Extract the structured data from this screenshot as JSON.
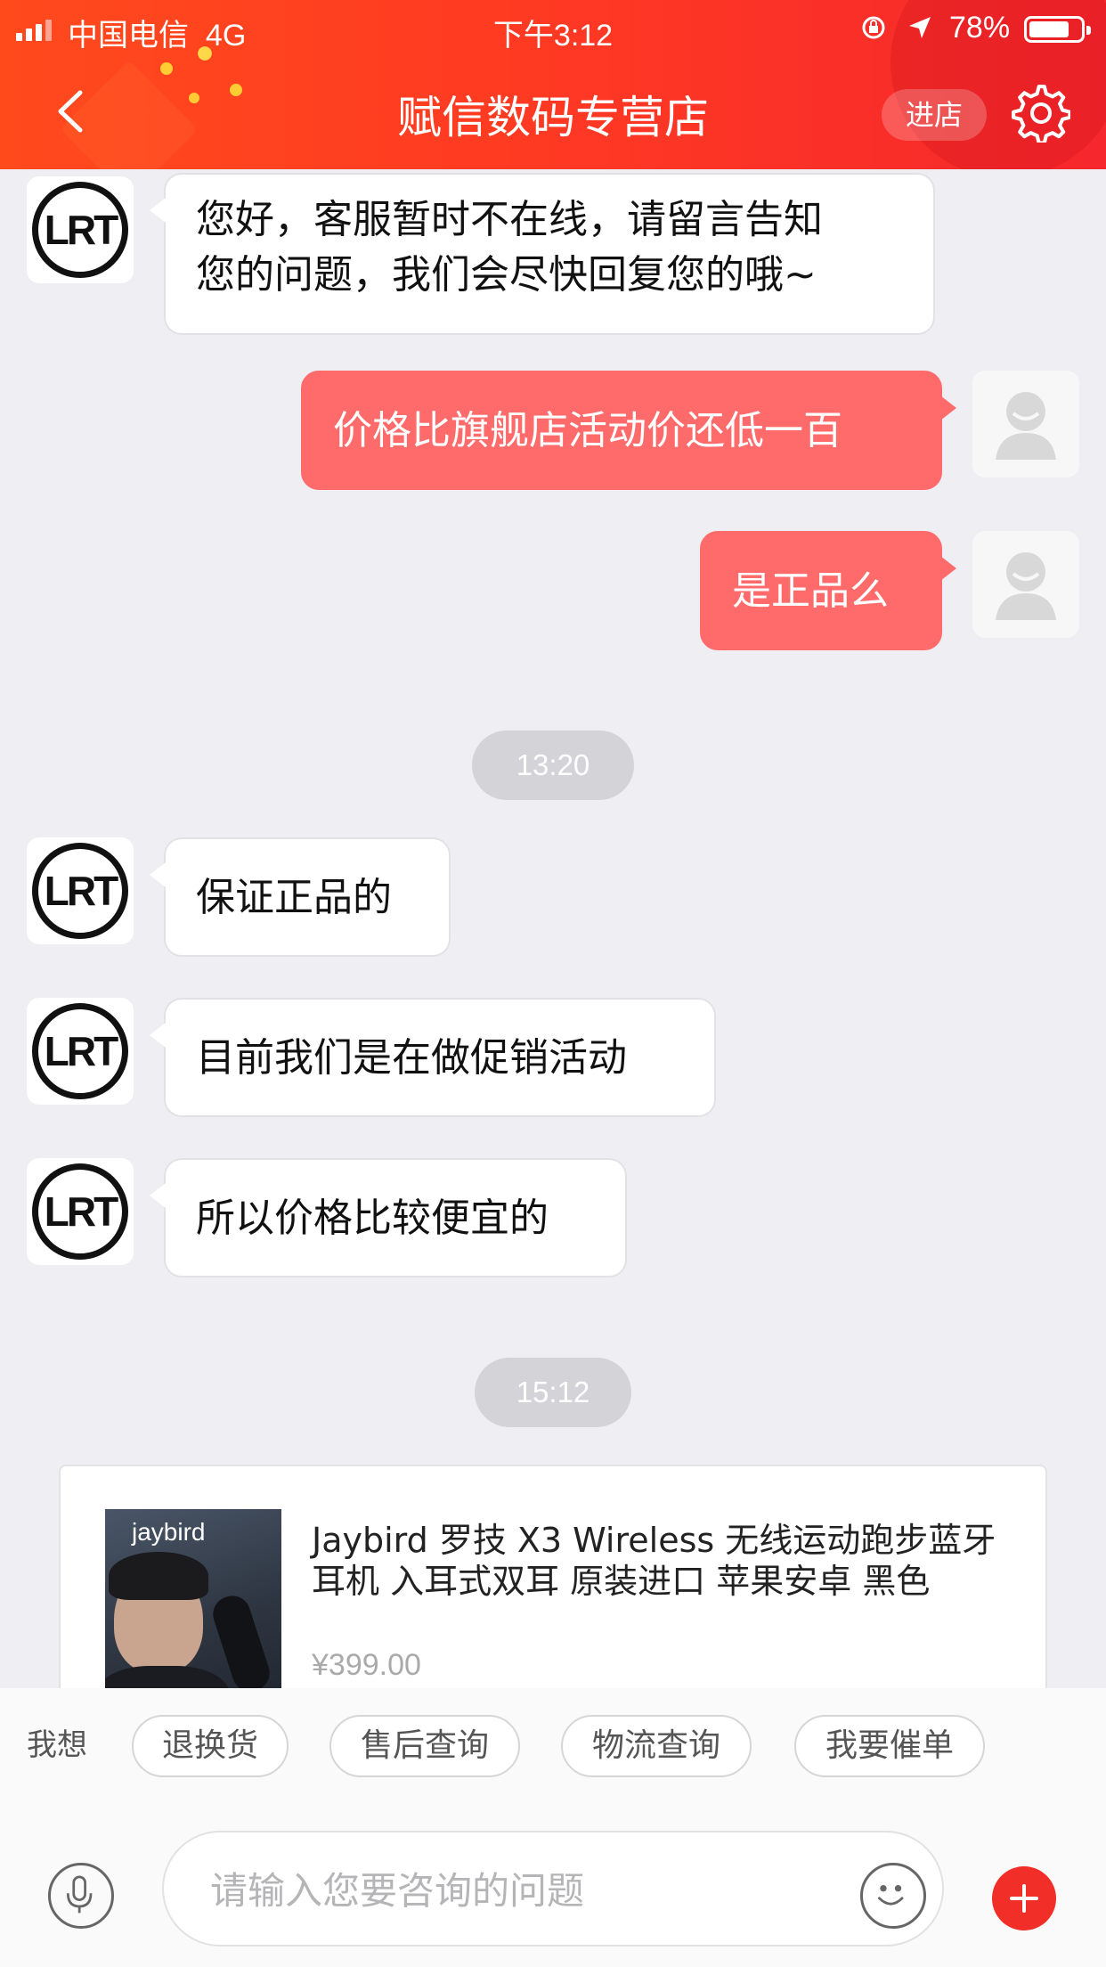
{
  "status_bar": {
    "carrier": "中国电信",
    "network": "4G",
    "time": "下午3:12",
    "battery": "78%",
    "battery_level": 0.78
  },
  "header": {
    "title": "赋信数码专营店",
    "enter_label": "进店"
  },
  "messages": [
    {
      "side": "left",
      "text_line1": "您好，客服暂时不在线，请留言告知",
      "text_line2": "您的问题，我们会尽快回复您的哦~"
    },
    {
      "side": "right",
      "text": "价格比旗舰店活动价还低一百"
    },
    {
      "side": "right",
      "text": "是正品么"
    },
    {
      "type": "timestamp",
      "text": "13:20"
    },
    {
      "side": "left",
      "text": "保证正品的"
    },
    {
      "side": "left",
      "text": "目前我们是在做促销活动"
    },
    {
      "side": "left",
      "text": "所以价格比较便宜的"
    },
    {
      "type": "timestamp",
      "text": "15:12"
    }
  ],
  "avatar": {
    "shop_logo_text": "LRT"
  },
  "product": {
    "brand_mark": "jaybird",
    "title_line1": "Jaybird 罗技  X3 Wireless 无线运动跑步蓝牙",
    "title_line2": "耳机 入耳式双耳 原装进口 苹果安卓 黑色",
    "price": "¥399.00"
  },
  "quick_actions": {
    "label": "我想",
    "items": [
      "退换货",
      "售后查询",
      "物流查询",
      "我要催单"
    ]
  },
  "input": {
    "placeholder": "请输入您要咨询的问题"
  },
  "colors": {
    "header_red": "#ff3b22",
    "bubble_red": "#ff6a6b",
    "plus_red": "#f22e28"
  }
}
